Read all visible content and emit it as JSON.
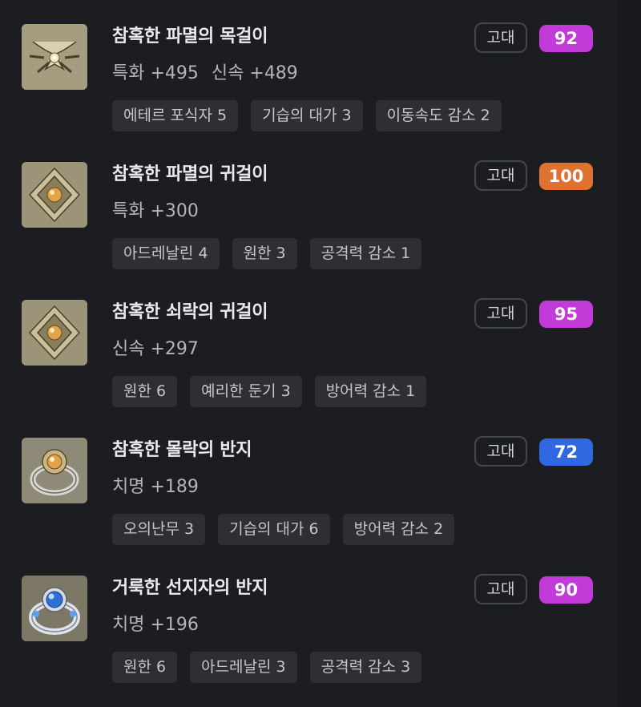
{
  "items": [
    {
      "name": "참혹한 파멸의 목걸이",
      "stats": [
        "특화 +495",
        "신속 +489"
      ],
      "grade": "고대",
      "quality": "92",
      "quality_color": "#c23ad8",
      "engravings": [
        "에테르 포식자 5",
        "기습의 대가 3",
        "이동속도 감소 2"
      ],
      "icon": "necklace-icon"
    },
    {
      "name": "참혹한 파멸의 귀걸이",
      "stats": [
        "특화 +300"
      ],
      "grade": "고대",
      "quality": "100",
      "quality_color": "#e0722f",
      "engravings": [
        "아드레날린 4",
        "원한 3",
        "공격력 감소 1"
      ],
      "icon": "earring-icon"
    },
    {
      "name": "참혹한 쇠락의 귀걸이",
      "stats": [
        "신속 +297"
      ],
      "grade": "고대",
      "quality": "95",
      "quality_color": "#c23ad8",
      "engravings": [
        "원한 6",
        "예리한 둔기 3",
        "방어력 감소 1"
      ],
      "icon": "earring-icon"
    },
    {
      "name": "참혹한 몰락의 반지",
      "stats": [
        "치명 +189"
      ],
      "grade": "고대",
      "quality": "72",
      "quality_color": "#2f68e0",
      "engravings": [
        "오의난무 3",
        "기습의 대가 6",
        "방어력 감소 2"
      ],
      "icon": "ring-icon"
    },
    {
      "name": "거룩한 선지자의 반지",
      "stats": [
        "치명 +196"
      ],
      "grade": "고대",
      "quality": "90",
      "quality_color": "#c23ad8",
      "engravings": [
        "원한 6",
        "아드레날린 3",
        "공격력 감소 3"
      ],
      "icon": "sapphire-ring-icon"
    }
  ]
}
